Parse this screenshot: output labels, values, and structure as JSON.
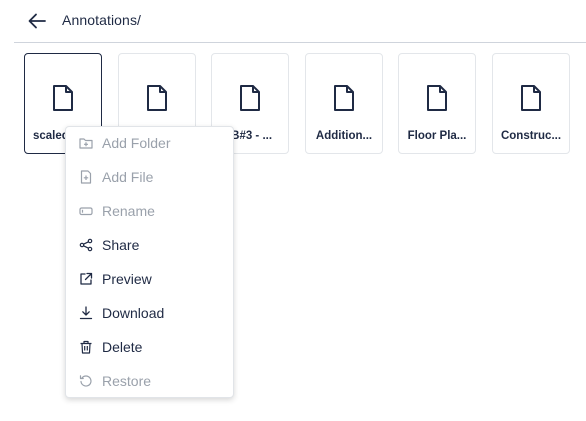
{
  "header": {
    "title": "Annotations/",
    "back_icon": "arrow-left-icon"
  },
  "tiles": [
    {
      "label": "scaled",
      "icon": "file-icon",
      "selected": true
    },
    {
      "label": "",
      "icon": "file-icon",
      "selected": false
    },
    {
      "label": "IB#3 - ...",
      "icon": "file-icon",
      "selected": false
    },
    {
      "label": "Addition...",
      "icon": "file-icon",
      "selected": false
    },
    {
      "label": "Floor Pla...",
      "icon": "file-icon",
      "selected": false
    },
    {
      "label": "Construc...",
      "icon": "file-icon",
      "selected": false
    }
  ],
  "context_menu": {
    "items": [
      {
        "label": "Add Folder",
        "icon": "folder-plus-icon",
        "enabled": false
      },
      {
        "label": "Add File",
        "icon": "file-plus-icon",
        "enabled": false
      },
      {
        "label": "Rename",
        "icon": "rename-icon",
        "enabled": false
      },
      {
        "label": "Share",
        "icon": "share-icon",
        "enabled": true
      },
      {
        "label": "Preview",
        "icon": "external-link-icon",
        "enabled": true
      },
      {
        "label": "Download",
        "icon": "download-icon",
        "enabled": true
      },
      {
        "label": "Delete",
        "icon": "trash-icon",
        "enabled": true
      },
      {
        "label": "Restore",
        "icon": "restore-icon",
        "enabled": false
      }
    ]
  },
  "colors": {
    "text": "#1f2a44",
    "disabled": "#9aa1ab",
    "border": "#e3e6ea"
  }
}
